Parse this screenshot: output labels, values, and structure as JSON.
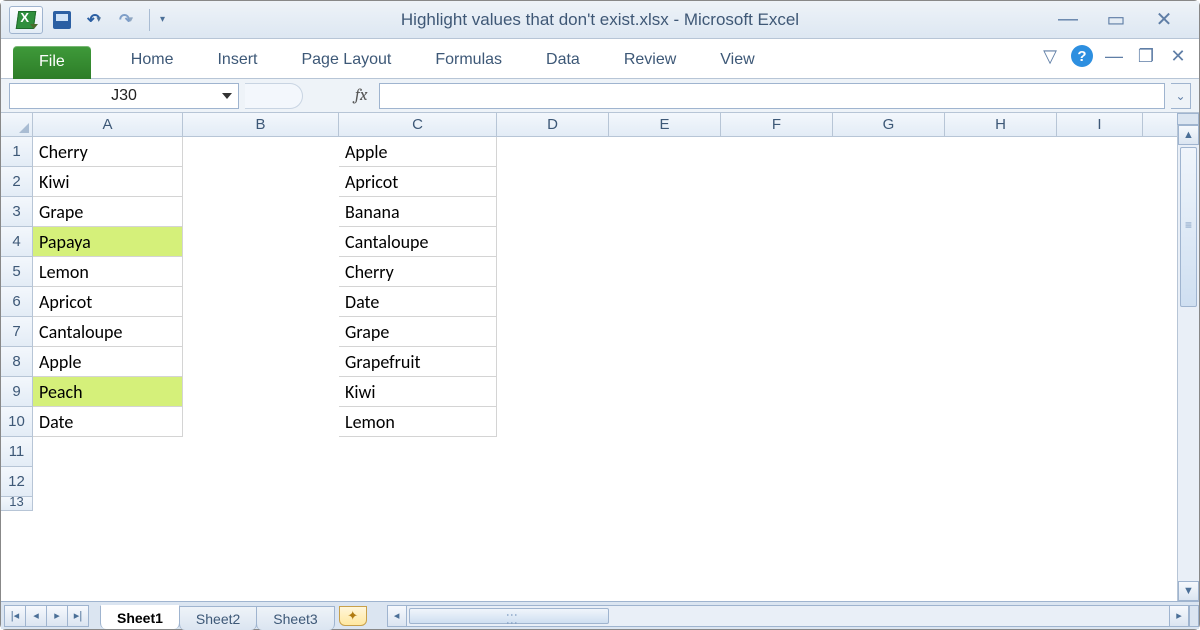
{
  "window": {
    "title": "Highlight values that don't exist.xlsx  -  Microsoft Excel"
  },
  "ribbon": {
    "file": "File",
    "tabs": [
      "Home",
      "Insert",
      "Page Layout",
      "Formulas",
      "Data",
      "Review",
      "View"
    ]
  },
  "namebox": {
    "value": "J30"
  },
  "formula": {
    "label": "fx",
    "value": ""
  },
  "columns": [
    "A",
    "B",
    "C",
    "D",
    "E",
    "F",
    "G",
    "H",
    "I"
  ],
  "rows": [
    {
      "n": "1",
      "A": "Cherry",
      "C": "Apple",
      "hlA": false
    },
    {
      "n": "2",
      "A": "Kiwi",
      "C": "Apricot",
      "hlA": false
    },
    {
      "n": "3",
      "A": "Grape",
      "C": "Banana",
      "hlA": false
    },
    {
      "n": "4",
      "A": "Papaya",
      "C": "Cantaloupe",
      "hlA": true
    },
    {
      "n": "5",
      "A": "Lemon",
      "C": "Cherry",
      "hlA": false
    },
    {
      "n": "6",
      "A": "Apricot",
      "C": "Date",
      "hlA": false
    },
    {
      "n": "7",
      "A": "Cantaloupe",
      "C": "Grape",
      "hlA": false
    },
    {
      "n": "8",
      "A": "Apple",
      "C": "Grapefruit",
      "hlA": false
    },
    {
      "n": "9",
      "A": "Peach",
      "C": "Kiwi",
      "hlA": true
    },
    {
      "n": "10",
      "A": "Date",
      "C": "Lemon",
      "hlA": false
    },
    {
      "n": "11",
      "A": "",
      "C": "",
      "hlA": false
    },
    {
      "n": "12",
      "A": "",
      "C": "",
      "hlA": false
    },
    {
      "n": "13",
      "A": "",
      "C": "",
      "hlA": false,
      "short": true
    }
  ],
  "sheets": {
    "items": [
      "Sheet1",
      "Sheet2",
      "Sheet3"
    ],
    "active": 0
  }
}
